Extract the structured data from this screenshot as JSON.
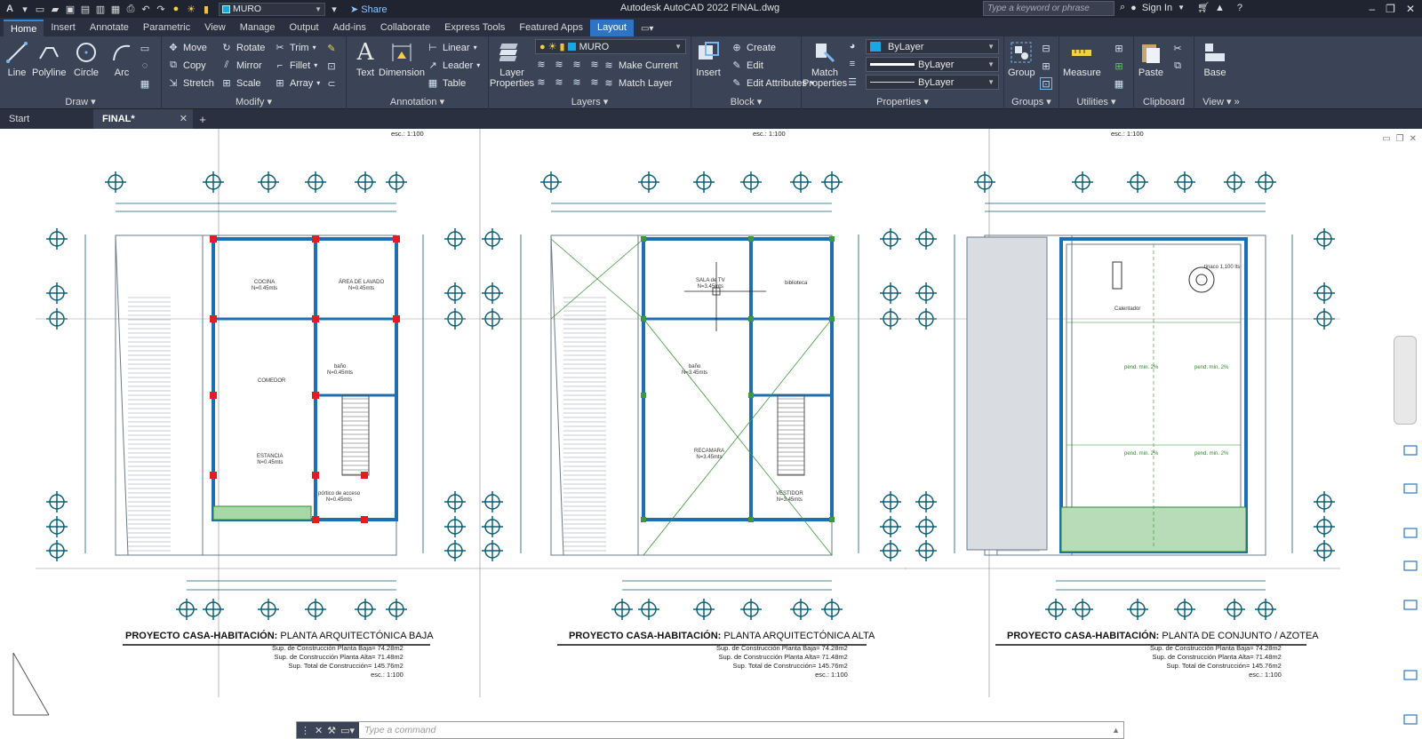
{
  "titlebar": {
    "logo": "A",
    "layer_current": "MURO",
    "share": "Share",
    "app_title": "Autodesk AutoCAD 2022   FINAL.dwg",
    "search_placeholder": "Type a keyword or phrase",
    "sign_in": "Sign In"
  },
  "ribbon_tabs": [
    "Home",
    "Insert",
    "Annotate",
    "Parametric",
    "View",
    "Manage",
    "Output",
    "Add-ins",
    "Collaborate",
    "Express Tools",
    "Featured Apps",
    "Layout"
  ],
  "ribbon": {
    "draw": {
      "title": "Draw",
      "line": "Line",
      "polyline": "Polyline",
      "circle": "Circle",
      "arc": "Arc"
    },
    "modify": {
      "title": "Modify",
      "move": "Move",
      "rotate": "Rotate",
      "trim": "Trim",
      "copy": "Copy",
      "mirror": "Mirror",
      "fillet": "Fillet",
      "stretch": "Stretch",
      "scale": "Scale",
      "array": "Array"
    },
    "annotation": {
      "title": "Annotation",
      "text": "Text",
      "dimension": "Dimension",
      "linear": "Linear",
      "leader": "Leader",
      "table": "Table"
    },
    "layers": {
      "title": "Layers",
      "layer_properties": "Layer\nProperties",
      "layer_value": "MURO",
      "make_current": "Make Current",
      "match_layer": "Match Layer"
    },
    "block": {
      "title": "Block",
      "insert": "Insert",
      "create": "Create",
      "edit": "Edit",
      "edit_attributes": "Edit Attributes"
    },
    "properties": {
      "title": "Properties",
      "match_properties": "Match\nProperties",
      "color": "ByLayer",
      "linetype": "ByLayer",
      "lineweight": "ByLayer"
    },
    "groups": {
      "title": "Groups",
      "group": "Group"
    },
    "utilities": {
      "title": "Utilities",
      "measure": "Measure"
    },
    "clipboard": {
      "title": "Clipboard",
      "paste": "Paste"
    },
    "view": {
      "title": "View",
      "base": "Base"
    }
  },
  "file_tabs": [
    {
      "label": "Start",
      "active": false
    },
    {
      "label": "FINAL*",
      "active": true,
      "close": "✕"
    }
  ],
  "plans": [
    {
      "title_bold": "PROYECTO CASA-HABITACIÓN:",
      "title_rest": " PLANTA ARQUITECTÓNICA BAJA",
      "notes": [
        "Sup. de Construcción Planta Baja= 74.28m2",
        "Sup. de Construcción Planta Alta= 71.48m2",
        "Sup. Total de Construcción= 145.76m2",
        "esc.: 1:100"
      ]
    },
    {
      "title_bold": "PROYECTO CASA-HABITACIÓN:",
      "title_rest": " PLANTA ARQUITECTÓNICA ALTA",
      "notes": [
        "Sup. de Construcción Planta Baja= 74.28m2",
        "Sup. de Construcción Planta Alta= 71.48m2",
        "Sup. Total de Construcción= 145.76m2",
        "esc.: 1:100"
      ]
    },
    {
      "title_bold": "PROYECTO CASA-HABITACIÓN:",
      "title_rest": " PLANTA DE CONJUNTO / AZOTEA",
      "notes": [
        "Sup. de Construcción Planta Baja= 74.28m2",
        "Sup. de Construcción Planta Alta= 71.48m2",
        "Sup. Total de Construcción= 145.76m2",
        "esc.: 1:100"
      ]
    }
  ],
  "top_scale_labels": [
    "esc.: 1:100",
    "esc.: 1:100",
    "esc.: 1:100"
  ],
  "rooms": {
    "cocina": "COCINA\nN=0.45mts",
    "lavado": "ÁREA DE LAVADO\nN=0.45mts",
    "comedor": "COMEDOR",
    "bano1": "baño\nN=0.45mts",
    "estancia": "ESTANCIA\nN=0.45mts",
    "portico": "pórtico de acceso\nN=0.45mts",
    "sala_tv": "SALA de TV\nN=3.45mts",
    "biblioteca": "biblioteca",
    "bano2": "baño\nN=3.45mts",
    "recamara": "RECAMARA\nN=3.45mts",
    "vestidor": "VESTIDOR\nN=3.45mts",
    "calentador": "Calentador",
    "tinaco": "tinaco 1,100 lts",
    "pend1": "pend. min. 2%",
    "pend2": "pend. min. 2%",
    "pend3": "pend. min. 2%",
    "pend4": "pend. min. 2%"
  },
  "command": {
    "placeholder": "Type a command"
  },
  "colors": {
    "accent": "#2f74c4",
    "ribbon_bg": "#3b4456",
    "title_bg": "#1f2430",
    "wall_blue": "#1f6fb0",
    "grid_teal": "#0b5f78",
    "column_red": "#e31b23"
  }
}
